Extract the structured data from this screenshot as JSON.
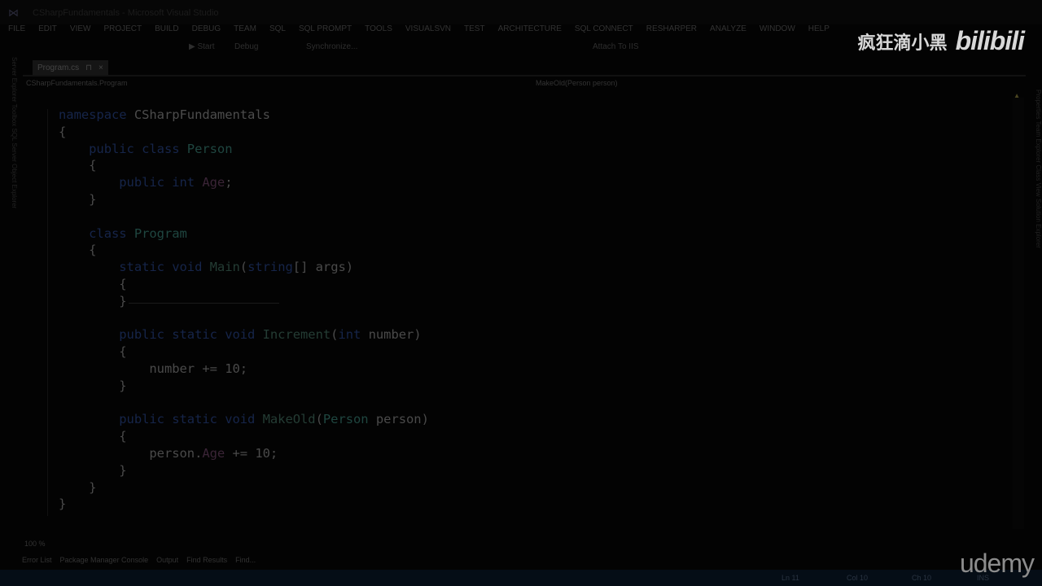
{
  "window": {
    "title": "CSharpFundamentals - Microsoft Visual Studio"
  },
  "menu": [
    "FILE",
    "EDIT",
    "VIEW",
    "PROJECT",
    "BUILD",
    "DEBUG",
    "TEAM",
    "SQL",
    "SQL PROMPT",
    "TOOLS",
    "VISUALSVN",
    "TEST",
    "ARCHITECTURE",
    "SQL CONNECT",
    "RESHARPER",
    "ANALYZE",
    "WINDOW",
    "HELP"
  ],
  "toolbar": {
    "start": "▶ Start",
    "config": "Debug",
    "sync": "Synchronize...",
    "attach": "Attach To IIS"
  },
  "tab": {
    "label": "Program.cs",
    "pin": "⊓",
    "close": "×"
  },
  "nav": {
    "left": "CSharpFundamentals.Program",
    "right": "MakeOld(Person person)"
  },
  "left_rail": "Server Explorer  Toolbox  SQL Server Object Explorer",
  "right_rail": "Properties  Team Explorer  Class View  Solution Explorer",
  "code": [
    [
      [
        "namespace ",
        "kw"
      ],
      [
        "CSharpFundamentals",
        "id"
      ]
    ],
    [
      [
        "{",
        "pl"
      ]
    ],
    [
      [
        "    public class ",
        "kw"
      ],
      [
        "Person",
        "ty"
      ]
    ],
    [
      [
        "    {",
        "pl"
      ]
    ],
    [
      [
        "        public int ",
        "kw"
      ],
      [
        "Age",
        "fld"
      ],
      [
        ";",
        "pl"
      ]
    ],
    [
      [
        "    }",
        "pl"
      ]
    ],
    [],
    [
      [
        "    class ",
        "kw"
      ],
      [
        "Program",
        "ty"
      ]
    ],
    [
      [
        "    {",
        "pl"
      ]
    ],
    [
      [
        "        static void ",
        "kw"
      ],
      [
        "Main",
        "fn"
      ],
      [
        "(",
        "pl"
      ],
      [
        "string",
        "kw"
      ],
      [
        "[] args)",
        "pl"
      ]
    ],
    [
      [
        "        {",
        "pl"
      ]
    ],
    [
      [
        "        }",
        "pl"
      ]
    ],
    [],
    [
      [
        "        public static void ",
        "kw"
      ],
      [
        "Increment",
        "fn"
      ],
      [
        "(",
        "pl"
      ],
      [
        "int ",
        "kw"
      ],
      [
        "number)",
        "pl"
      ]
    ],
    [
      [
        "        {",
        "pl"
      ]
    ],
    [
      [
        "            number += 10;",
        "pl"
      ]
    ],
    [
      [
        "        }",
        "pl"
      ]
    ],
    [],
    [
      [
        "        public static void ",
        "kw"
      ],
      [
        "MakeOld",
        "fn"
      ],
      [
        "(",
        "pl"
      ],
      [
        "Person ",
        "ty"
      ],
      [
        "person)",
        "pl"
      ]
    ],
    [
      [
        "        {",
        "pl"
      ]
    ],
    [
      [
        "            person.",
        "pl"
      ],
      [
        "Age",
        "fld"
      ],
      [
        " += 10;",
        "pl"
      ]
    ],
    [
      [
        "        }",
        "pl"
      ]
    ],
    [
      [
        "    }",
        "pl"
      ]
    ],
    [
      [
        "}",
        "pl"
      ]
    ]
  ],
  "zoom": "100 %",
  "bottom_tabs": [
    "Error List",
    "Package Manager Console",
    "Output",
    "Find Results",
    "Find..."
  ],
  "status": {
    "ln": "Ln 11",
    "col": "Col 10",
    "ch": "Ch 10",
    "ins": "INS"
  },
  "watermark": {
    "channel": "疯狂滴小黑",
    "bilibili": "bilibili",
    "udemy": "udemy"
  }
}
